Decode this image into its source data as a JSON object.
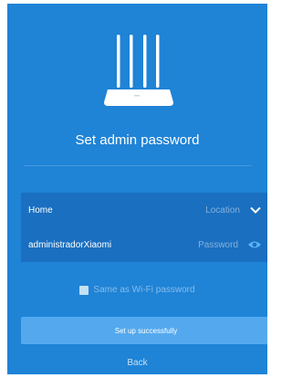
{
  "header": {
    "title": "Set admin password",
    "illustration_icon": "router-icon"
  },
  "form": {
    "location": {
      "value": "Home",
      "label": "Location",
      "icon": "chevron-down-icon"
    },
    "password": {
      "value": "administradorXiaomi",
      "label": "Password",
      "icon": "eye-icon"
    },
    "same_as_wifi": {
      "label": "Same as Wi-Fi password",
      "checked": false
    }
  },
  "actions": {
    "primary_label": "Set up successfully",
    "back_label": "Back"
  },
  "colors": {
    "background": "#1f83d6",
    "field": "#1a6fc0",
    "primary_button": "#54a9ee"
  }
}
